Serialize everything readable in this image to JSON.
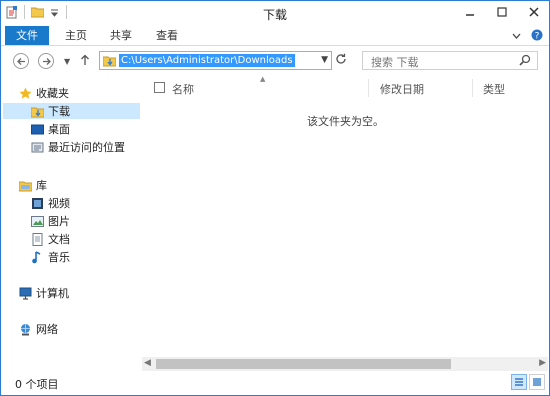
{
  "window": {
    "title": "下载"
  },
  "ribbon": {
    "file_tab": "文件",
    "tabs": [
      "主页",
      "共享",
      "查看"
    ]
  },
  "address": {
    "path": "C:\\Users\\Administrator\\Downloads"
  },
  "search": {
    "placeholder": "搜索 下载"
  },
  "nav": {
    "favorites": "收藏夹",
    "favorites_items": [
      "下载",
      "桌面",
      "最近访问的位置"
    ],
    "libraries": "库",
    "libraries_items": [
      "视频",
      "图片",
      "文档",
      "音乐"
    ],
    "computer": "计算机",
    "network": "网络"
  },
  "columns": {
    "name": "名称",
    "modified": "修改日期",
    "type": "类型"
  },
  "content": {
    "empty_text": "该文件夹为空。"
  },
  "status": {
    "item_count": "0 个项目"
  },
  "colors": {
    "accent": "#1979ca",
    "selection": "#cce8ff",
    "address_highlight": "#3399ff"
  },
  "icons": [
    "properties-icon",
    "new-folder-icon",
    "customize-qa-icon",
    "minimize-icon",
    "maximize-icon",
    "close-icon",
    "ribbon-expand-icon",
    "help-icon",
    "back-icon",
    "forward-icon",
    "recent-locations-icon",
    "up-icon",
    "folder-icon",
    "refresh-icon",
    "search-icon",
    "star-icon",
    "library-icon",
    "computer-icon",
    "network-icon",
    "details-view-icon",
    "large-icons-view-icon"
  ]
}
